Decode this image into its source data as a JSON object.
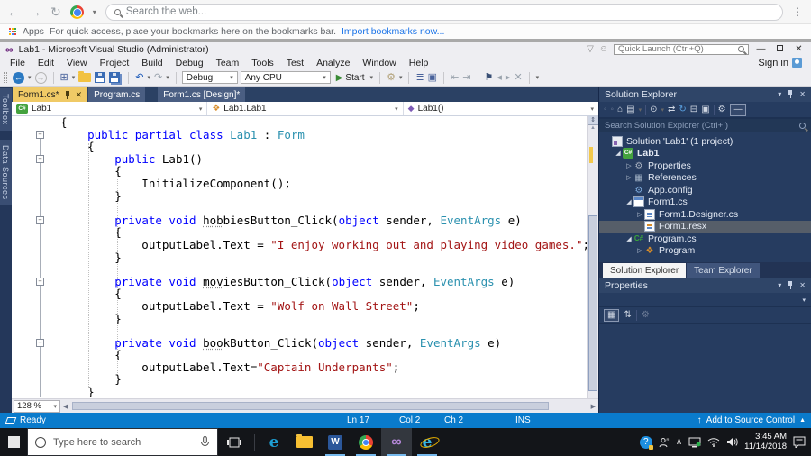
{
  "browser": {
    "search_placeholder": "Search the web...",
    "apps_label": "Apps",
    "bookmarks_hint": "For quick access, place your bookmarks here on the bookmarks bar.",
    "bookmarks_link": "Import bookmarks now..."
  },
  "vs": {
    "window_title": "Lab1 - Microsoft Visual Studio  (Administrator)",
    "quick_launch_placeholder": "Quick Launch (Ctrl+Q)",
    "sign_in_label": "Sign in",
    "menu": [
      "File",
      "Edit",
      "View",
      "Project",
      "Build",
      "Debug",
      "Team",
      "Tools",
      "Test",
      "Analyze",
      "Window",
      "Help"
    ],
    "toolbar": {
      "left_icons": [
        "nav-back",
        "caret",
        "nav-forward",
        "sep",
        "new-project",
        "caret",
        "open-folder",
        "save",
        "save-all",
        "sep",
        "undo",
        "caret",
        "redo",
        "caret",
        "sep"
      ],
      "config": "Debug",
      "platform": "Any CPU",
      "start_label": "Start",
      "right_icons": [
        "caret",
        "sep",
        "attach",
        "caret",
        "sep",
        "task-list",
        "find-symbol",
        "sep",
        "indent-decrease",
        "indent-increase",
        "sep",
        "bookmark",
        "prev-bookmark",
        "next-bookmark",
        "clear-bookmarks",
        "sep",
        "overflow"
      ]
    },
    "doc_tabs": [
      {
        "label": "Form1.cs*",
        "active": true
      },
      {
        "label": "Program.cs",
        "active": false
      },
      {
        "label": "Form1.cs [Design]*",
        "active": false
      }
    ],
    "navbar": [
      {
        "label": "Lab1",
        "icon": "cs-project"
      },
      {
        "label": "Lab1.Lab1",
        "icon": "class"
      },
      {
        "label": "Lab1()",
        "icon": "method"
      }
    ],
    "side_tabs": [
      "Toolbox",
      "Data Sources"
    ],
    "zoom_level": "128 %",
    "status": {
      "ready": "Ready",
      "line": "Ln 17",
      "column": "Col 2",
      "character": "Ch 2",
      "mode": "INS",
      "source_control": "Add to Source Control"
    }
  },
  "code": {
    "fold_lines": [
      2,
      4,
      9,
      14,
      19
    ],
    "lines": [
      [
        [
          "p",
          "{"
        ]
      ],
      [
        [
          "p",
          "    "
        ],
        [
          "k",
          "public partial class"
        ],
        [
          "p",
          " "
        ],
        [
          "t",
          "Lab1"
        ],
        [
          "p",
          " : "
        ],
        [
          "t",
          "Form"
        ]
      ],
      [
        [
          "p",
          "    {"
        ]
      ],
      [
        [
          "p",
          "        "
        ],
        [
          "k",
          "public"
        ],
        [
          "p",
          " Lab1()"
        ]
      ],
      [
        [
          "p",
          "        {"
        ]
      ],
      [
        [
          "p",
          "            InitializeComponent();"
        ]
      ],
      [
        [
          "p",
          "        }"
        ]
      ],
      [],
      [
        [
          "p",
          "        "
        ],
        [
          "k",
          "private void"
        ],
        [
          "p",
          " "
        ],
        [
          "m",
          "hob"
        ],
        [
          "p",
          "biesButton_Click("
        ],
        [
          "k",
          "object"
        ],
        [
          "p",
          " sender, "
        ],
        [
          "t",
          "EventArgs"
        ],
        [
          "p",
          " e)"
        ]
      ],
      [
        [
          "p",
          "        {"
        ]
      ],
      [
        [
          "p",
          "            outputLabel.Text = "
        ],
        [
          "s",
          "\"I enjoy working out and playing video games.\""
        ],
        [
          "p",
          ";"
        ]
      ],
      [
        [
          "p",
          "        }"
        ]
      ],
      [],
      [
        [
          "p",
          "        "
        ],
        [
          "k",
          "private void"
        ],
        [
          "p",
          " "
        ],
        [
          "m",
          "mov"
        ],
        [
          "p",
          "iesButton_Click("
        ],
        [
          "k",
          "object"
        ],
        [
          "p",
          " sender, "
        ],
        [
          "t",
          "EventArgs"
        ],
        [
          "p",
          " e)"
        ]
      ],
      [
        [
          "p",
          "        {"
        ]
      ],
      [
        [
          "p",
          "            outputLabel.Text = "
        ],
        [
          "s",
          "\"Wolf on Wall Street\""
        ],
        [
          "p",
          ";"
        ]
      ],
      [
        [
          "p",
          "        }"
        ]
      ],
      [],
      [
        [
          "p",
          "        "
        ],
        [
          "k",
          "private void"
        ],
        [
          "p",
          " "
        ],
        [
          "m",
          "boo"
        ],
        [
          "p",
          "kButton_Click("
        ],
        [
          "k",
          "object"
        ],
        [
          "p",
          " sender, "
        ],
        [
          "t",
          "EventArgs"
        ],
        [
          "p",
          " e)"
        ]
      ],
      [
        [
          "p",
          "        {"
        ]
      ],
      [
        [
          "p",
          "            outputLabel.Text="
        ],
        [
          "s",
          "\"Captain Underpants\""
        ],
        [
          "p",
          ";"
        ]
      ],
      [
        [
          "p",
          "        }"
        ]
      ],
      [
        [
          "p",
          "    }"
        ]
      ]
    ]
  },
  "solution_explorer": {
    "title": "Solution Explorer",
    "toolbar_icons": [
      "se-back",
      "se-forward",
      "se-home",
      "se-switch-views",
      "caret",
      "sep",
      "se-pending-changes",
      "caret",
      "se-sync",
      "se-refresh",
      "se-collapse-all",
      "se-preview",
      "sep",
      "se-properties",
      "se-code-view"
    ],
    "search_placeholder": "Search Solution Explorer (Ctrl+;)",
    "items": [
      {
        "label": "Solution 'Lab1' (1 project)",
        "icon": "sln",
        "indent": 0,
        "arrow": "none"
      },
      {
        "label": "Lab1",
        "icon": "csproj",
        "indent": 1,
        "arrow": "expanded",
        "bold": true
      },
      {
        "label": "Properties",
        "icon": "wrench",
        "indent": 2,
        "arrow": "collapsed"
      },
      {
        "label": "References",
        "icon": "refs",
        "indent": 2,
        "arrow": "collapsed"
      },
      {
        "label": "App.config",
        "icon": "config",
        "indent": 2,
        "arrow": "none"
      },
      {
        "label": "Form1.cs",
        "icon": "form",
        "indent": 2,
        "arrow": "expanded"
      },
      {
        "label": "Form1.Designer.cs",
        "icon": "page",
        "indent": 3,
        "arrow": "collapsed"
      },
      {
        "label": "Form1.resx",
        "icon": "resx",
        "indent": 3,
        "arrow": "none",
        "selected": true
      },
      {
        "label": "Program.cs",
        "icon": "cs",
        "indent": 2,
        "arrow": "expanded"
      },
      {
        "label": "Program",
        "icon": "class",
        "indent": 3,
        "arrow": "collapsed"
      }
    ],
    "bottom_tabs": [
      {
        "label": "Solution Explorer",
        "active": true
      },
      {
        "label": "Team Explorer",
        "active": false
      }
    ]
  },
  "properties_panel": {
    "title": "Properties",
    "toolbar_icons": [
      "props-categorized",
      "props-alphabetical",
      "sep",
      "props-pages"
    ]
  },
  "taskbar": {
    "search_placeholder": "Type here to search",
    "apps": [
      {
        "name": "edge",
        "running": false,
        "active": false
      },
      {
        "name": "file-explorer",
        "running": false,
        "active": false
      },
      {
        "name": "word",
        "running": true,
        "active": false
      },
      {
        "name": "chrome",
        "running": true,
        "active": false
      },
      {
        "name": "visual-studio",
        "running": true,
        "active": true
      },
      {
        "name": "internet-explorer",
        "running": true,
        "active": false
      }
    ],
    "tray_icons": [
      "help",
      "people",
      "chevron-up",
      "pc-status",
      "wifi",
      "volume"
    ],
    "time": "3:45 AM",
    "date": "11/14/2018"
  }
}
